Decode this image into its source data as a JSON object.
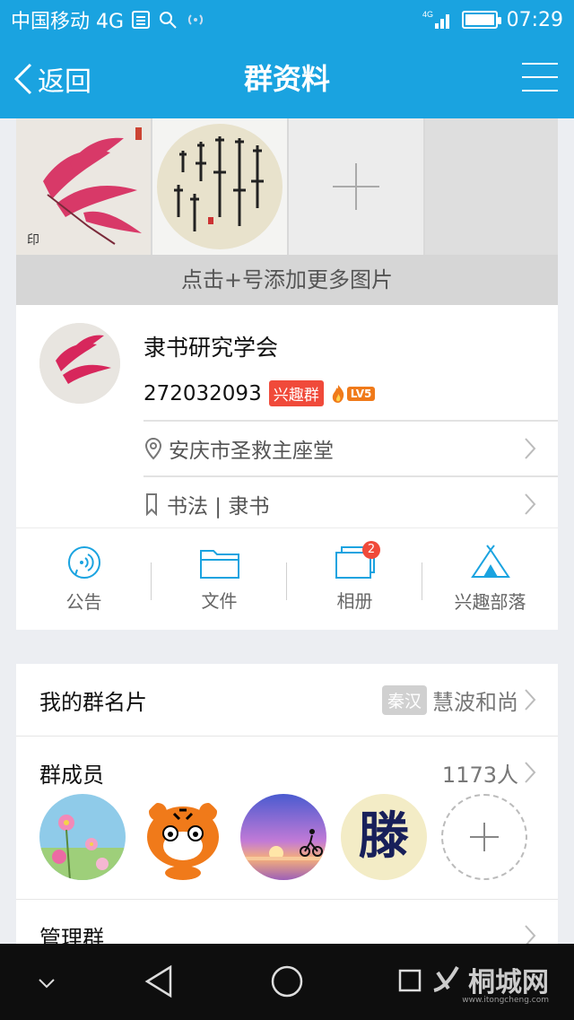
{
  "status_bar": {
    "carrier": "中国移动 4G",
    "network": "4G",
    "time": "07:29"
  },
  "header": {
    "back_label": "返回",
    "title": "群资料"
  },
  "photos": {
    "add_hint": "点击+号添加更多图片"
  },
  "group": {
    "name": "隶书研究学会",
    "id": "272032093",
    "interest_tag": "兴趣群",
    "level": "LV5",
    "location": "安庆市圣救主座堂",
    "category": "书法 | 隶书"
  },
  "actions": [
    {
      "label": "公告",
      "icon": "announcement-icon"
    },
    {
      "label": "文件",
      "icon": "folder-icon"
    },
    {
      "label": "相册",
      "icon": "album-icon",
      "badge": "2"
    },
    {
      "label": "兴趣部落",
      "icon": "tent-icon"
    }
  ],
  "my_card": {
    "label": "我的群名片",
    "title_tag": "秦汉",
    "nickname": "慧波和尚"
  },
  "members": {
    "label": "群成员",
    "count": "1173人"
  },
  "manage": {
    "label": "管理群"
  },
  "watermark": {
    "name": "桐城网",
    "url": "www.itongcheng.com"
  },
  "colors": {
    "primary": "#1aa3e0",
    "interest_tag": "#f04a3a",
    "level": "#f07a1a"
  }
}
